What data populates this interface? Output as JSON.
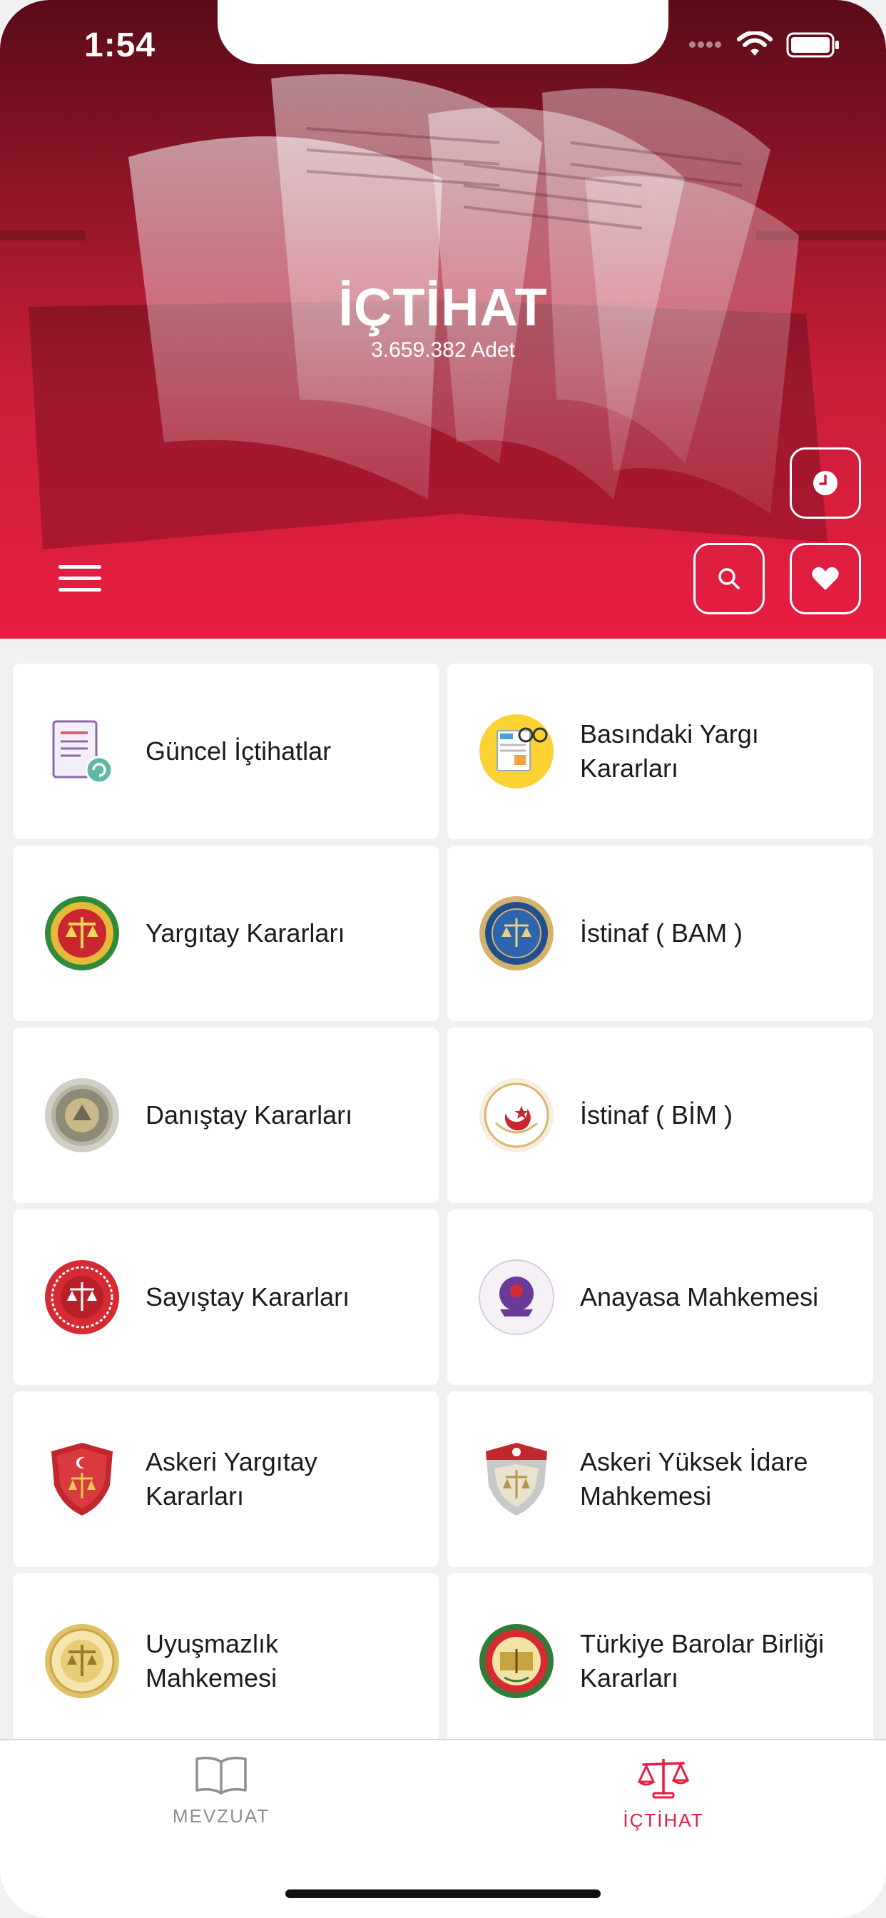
{
  "status": {
    "time": "1:54"
  },
  "header": {
    "title": "İÇTİHAT",
    "subtitle": "3.659.382 Adet"
  },
  "colors": {
    "accent": "#e81d41",
    "header_dark": "#5a0b17"
  },
  "icons": {
    "menu": "hamburger-icon",
    "history": "clock-icon",
    "search": "search-icon",
    "favorites": "heart-icon"
  },
  "cards": [
    {
      "label": "Güncel İçtihatlar",
      "icon": "document-refresh-icon"
    },
    {
      "label": "Basındaki Yargı Kararları",
      "icon": "newspaper-icon"
    },
    {
      "label": "Yargıtay Kararları",
      "icon": "yargitay-seal-icon"
    },
    {
      "label": "İstinaf ( BAM )",
      "icon": "bam-seal-icon"
    },
    {
      "label": "Danıştay Kararları",
      "icon": "danistay-seal-icon"
    },
    {
      "label": "İstinaf ( BİM )",
      "icon": "bim-seal-icon"
    },
    {
      "label": "Sayıştay Kararları",
      "icon": "sayistay-seal-icon"
    },
    {
      "label": "Anayasa Mahkemesi",
      "icon": "anayasa-seal-icon"
    },
    {
      "label": "Askeri Yargıtay Kararları",
      "icon": "askeri-yargitay-shield-icon"
    },
    {
      "label": "Askeri Yüksek İdare Mahkemesi",
      "icon": "askeri-idare-shield-icon"
    },
    {
      "label": "Uyuşmazlık Mahkemesi",
      "icon": "uyusmazlik-seal-icon"
    },
    {
      "label": "Türkiye Barolar Birliği Kararları",
      "icon": "barolar-birligi-seal-icon"
    }
  ],
  "tabs": [
    {
      "label": "MEVZUAT",
      "icon": "book-icon",
      "active": false
    },
    {
      "label": "İÇTİHAT",
      "icon": "scales-icon",
      "active": true
    }
  ]
}
